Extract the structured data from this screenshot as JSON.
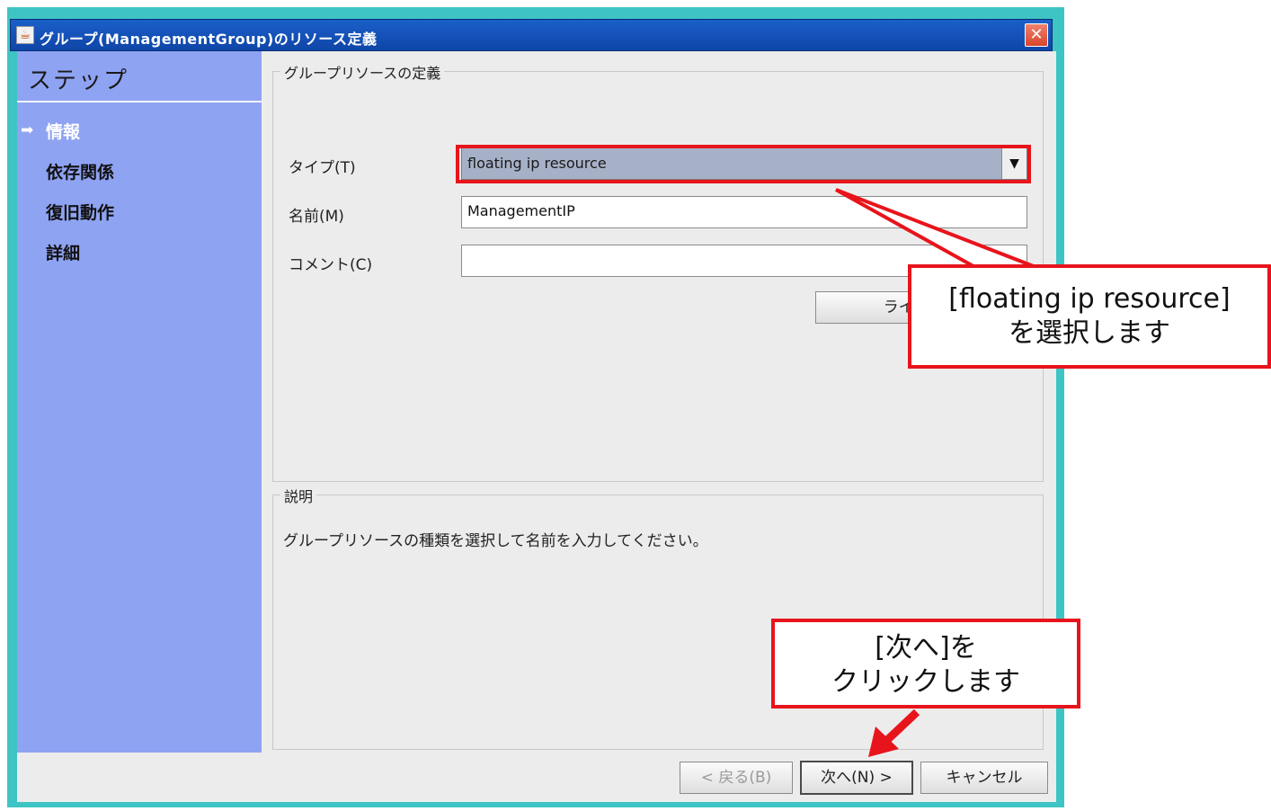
{
  "window": {
    "title": "グループ(ManagementGroup)のリソース定義",
    "title_icon": "java-cup-icon",
    "close_icon": "close-icon"
  },
  "sidebar": {
    "title": "ステップ",
    "current_arrow_icon": "arrow-right-icon",
    "steps": [
      {
        "label": "情報",
        "current": true
      },
      {
        "label": "依存関係",
        "current": false
      },
      {
        "label": "復旧動作",
        "current": false
      },
      {
        "label": "詳細",
        "current": false
      }
    ]
  },
  "definition": {
    "group_label": "グループリソースの定義",
    "type_label": "タイプ(T)",
    "type_value": "floating ip resource",
    "name_label": "名前(M)",
    "name_value": "ManagementIP",
    "comment_label": "コメント(C)",
    "comment_value": "",
    "license_button": "ライセンス"
  },
  "description": {
    "group_label": "説明",
    "text": "グループリソースの種類を選択して名前を入力してください。"
  },
  "footer": {
    "back_button": "< 戻る(B)",
    "next_button": "次へ(N) >",
    "cancel_button": "キャンセル"
  },
  "annotations": {
    "callout_type_line1": "[floating ip resource]",
    "callout_type_line2": "を選択します",
    "callout_next_line1": "[次へ]を",
    "callout_next_line2": "クリックします",
    "highlight_color": "#e8141c"
  },
  "colors": {
    "titlebar": "#1b5fc9",
    "sidebar": "#8fa3f3",
    "window_border": "#3ec4c4",
    "combo_selected": "#a6b1c7"
  }
}
